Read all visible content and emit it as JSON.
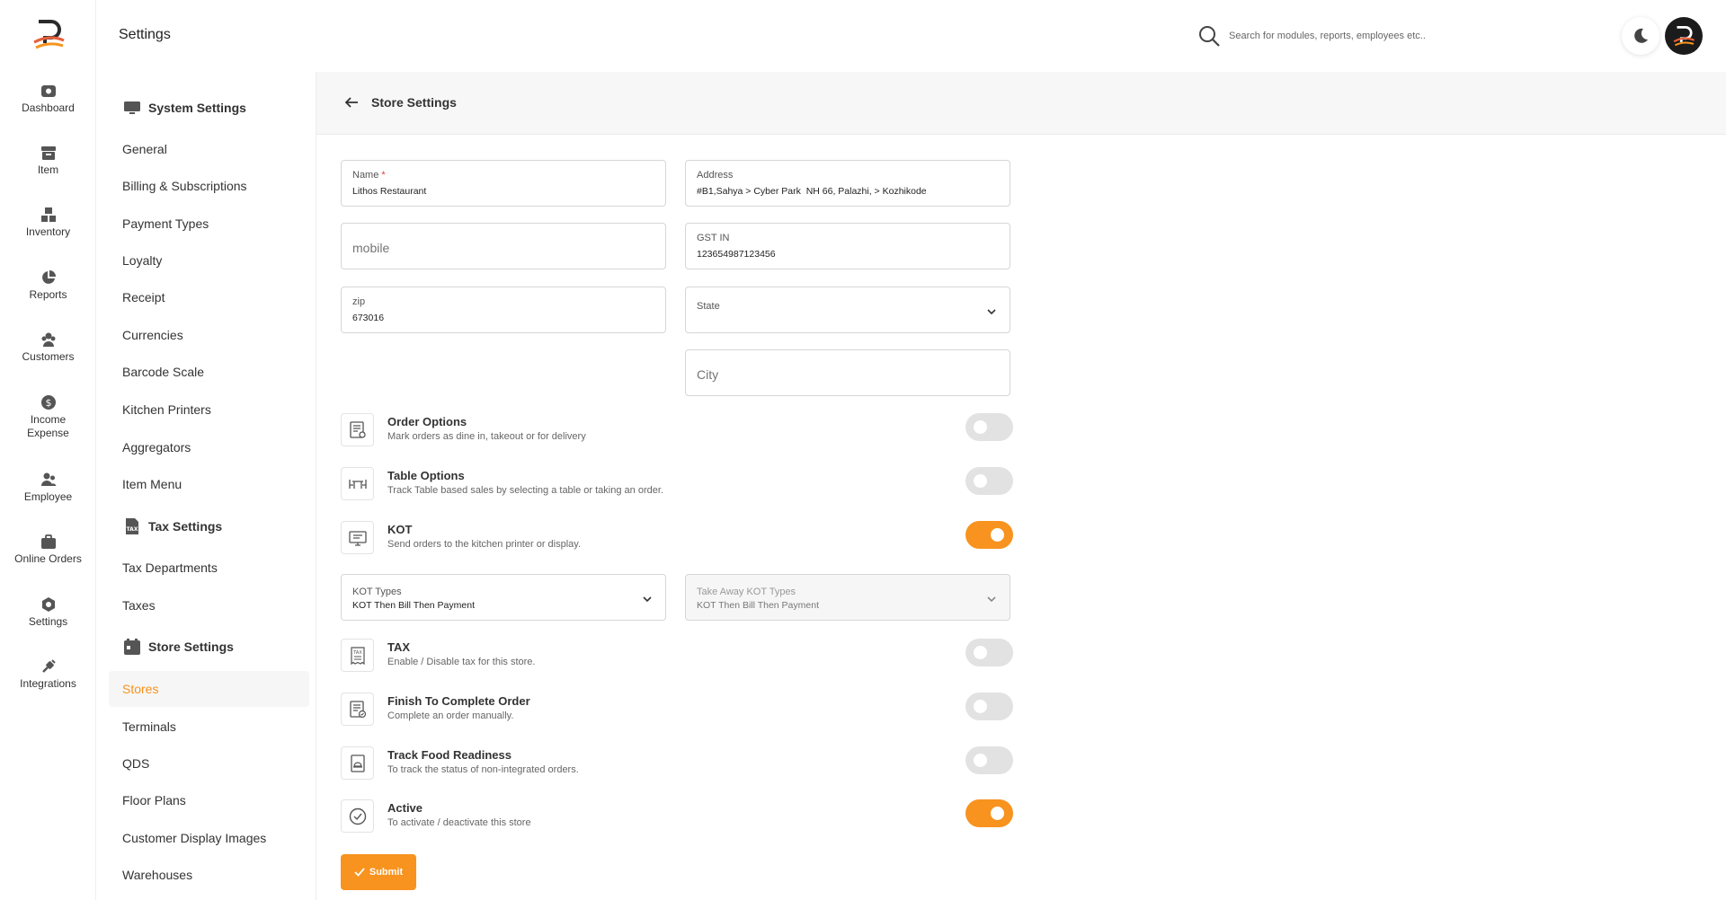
{
  "header": {
    "title": "Settings",
    "search_placeholder": "Search for modules, reports, employees etc.."
  },
  "rail": {
    "items": [
      {
        "label": "Dashboard",
        "icon": "dashboard-icon"
      },
      {
        "label": "Item",
        "icon": "item-icon"
      },
      {
        "label": "Inventory",
        "icon": "inventory-icon"
      },
      {
        "label": "Reports",
        "icon": "reports-icon"
      },
      {
        "label": "Customers",
        "icon": "customers-icon"
      },
      {
        "label": "Income Expense",
        "icon": "income-expense-icon"
      },
      {
        "label": "Employee",
        "icon": "employee-icon"
      },
      {
        "label": "Online Orders",
        "icon": "online-orders-icon"
      },
      {
        "label": "Settings",
        "icon": "settings-icon"
      },
      {
        "label": "Integrations",
        "icon": "integrations-icon"
      }
    ]
  },
  "sidebar": {
    "system_settings": "System Settings",
    "system_items": [
      "General",
      "Billing & Subscriptions",
      "Payment Types",
      "Loyalty",
      "Receipt",
      "Currencies",
      "Barcode Scale",
      "Kitchen Printers",
      "Aggregators",
      "Item Menu"
    ],
    "tax_settings": "Tax Settings",
    "tax_items": [
      "Tax Departments",
      "Taxes"
    ],
    "store_settings": "Store Settings",
    "store_items": [
      "Stores",
      "Terminals",
      "QDS",
      "Floor Plans",
      "Customer Display Images",
      "Warehouses"
    ],
    "active_item": "Stores"
  },
  "main": {
    "title": "Store Settings",
    "fields": {
      "name_label": "Name",
      "name_required": "*",
      "name_value": "Lithos Restaurant",
      "address_label": "Address",
      "address_value": "#B1,Sahya > Cyber Park  NH 66, Palazhi, > Kozhikode",
      "mobile_placeholder": "mobile",
      "gst_label": "GST IN",
      "gst_value": "123654987123456",
      "zip_label": "zip",
      "zip_value": "673016",
      "state_label": "State",
      "city_placeholder": "City",
      "kot_types_label": "KOT Types",
      "kot_types_value": "KOT Then Bill Then Payment",
      "takeaway_kot_label": "Take Away KOT Types",
      "takeaway_kot_value": "KOT Then Bill Then Payment"
    },
    "options": [
      {
        "title": "Order Options",
        "desc": "Mark orders as dine in, takeout or for delivery",
        "on": false
      },
      {
        "title": "Table Options",
        "desc": "Track Table based sales by selecting a table or taking an order.",
        "on": false
      },
      {
        "title": "KOT",
        "desc": "Send orders to the kitchen printer or display.",
        "on": true
      },
      {
        "title": "TAX",
        "desc": "Enable / Disable tax for this store.",
        "on": false
      },
      {
        "title": "Finish To Complete Order",
        "desc": "Complete an order manually.",
        "on": false
      },
      {
        "title": "Track Food Readiness",
        "desc": "To track the status of non-integrated orders.",
        "on": false
      },
      {
        "title": "Active",
        "desc": "To activate / deactivate this store",
        "on": true
      }
    ],
    "submit_label": "Submit"
  },
  "colors": {
    "accent": "#f7931e",
    "toggle_off": "#e2e2e2"
  }
}
